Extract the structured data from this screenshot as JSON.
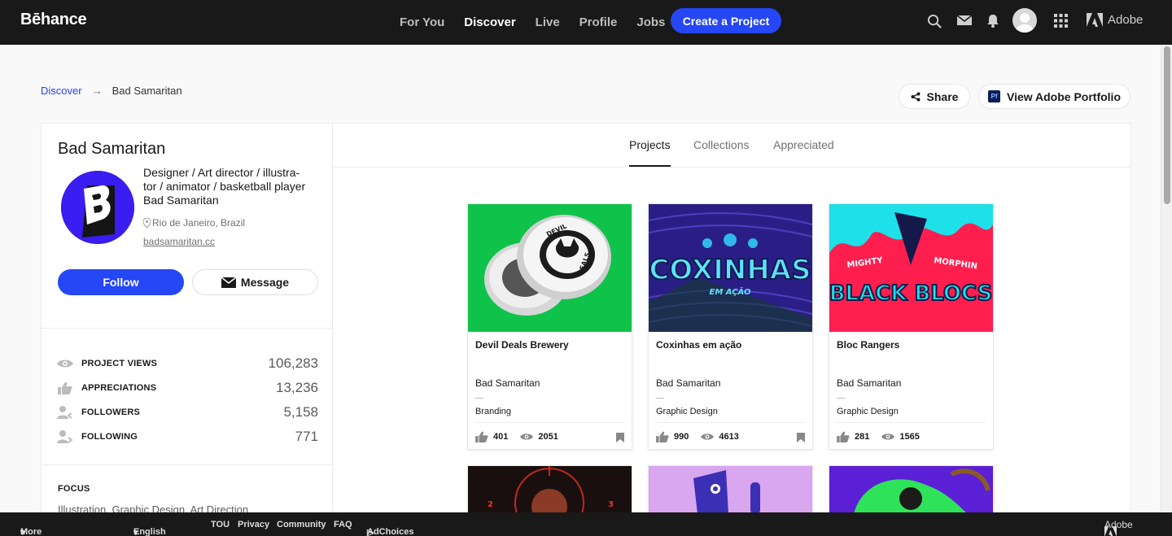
{
  "nav": {
    "logo": "Bēhance",
    "links": [
      "For You",
      "Discover",
      "Live",
      "Profile",
      "Jobs"
    ],
    "active": "Discover",
    "create_label": "Create a Project",
    "adobe_label": "Adobe"
  },
  "breadcrumb": {
    "root": "Discover",
    "current": "Bad Samaritan"
  },
  "actions": {
    "share_label": "Share",
    "portfolio_label": "View Adobe Portfolio",
    "portfolio_icon_text": "Pf"
  },
  "profile": {
    "name": "Bad Samaritan",
    "bio_lines": [
      "Designer / Art director / illustra-",
      "tor / animator / basketball player",
      "Bad Samaritan"
    ],
    "location": "Rio de Janeiro, Brazil",
    "website": "badsamaritan.cc",
    "follow_label": "Follow",
    "message_label": "Message"
  },
  "stats": [
    {
      "icon": "eye-icon",
      "label": "PROJECT VIEWS",
      "value": "106,283"
    },
    {
      "icon": "thumbs-up-icon",
      "label": "APPRECIATIONS",
      "value": "13,236"
    },
    {
      "icon": "followers-icon",
      "label": "FOLLOWERS",
      "value": "5,158"
    },
    {
      "icon": "following-icon",
      "label": "FOLLOWING",
      "value": "771"
    }
  ],
  "focus": {
    "title": "FOCUS",
    "value": "Illustration, Graphic Design, Art Direction"
  },
  "tabs": [
    "Projects",
    "Collections",
    "Appreciated"
  ],
  "active_tab": "Projects",
  "projects": [
    {
      "title": "Devil Deals Brewery",
      "owner": "Bad Samaritan",
      "field": "Branding",
      "likes": "401",
      "views": "2051",
      "cover_color": "#0fc34a"
    },
    {
      "title": "Coxinhas em ação",
      "owner": "Bad Samaritan",
      "field": "Graphic Design",
      "likes": "990",
      "views": "4613",
      "cover_color": "#2a1e86"
    },
    {
      "title": "Bloc Rangers",
      "owner": "Bad Samaritan",
      "field": "Graphic Design",
      "likes": "281",
      "views": "1565",
      "cover_color": "#ff1f4f"
    }
  ],
  "cover_text": {
    "p1": [
      "DEVIL",
      "DEALS"
    ],
    "p2": [
      "COXINHAS",
      "EM AÇÃO"
    ],
    "p3": [
      "MIGHTY",
      "MORPHIN",
      "BLACK BLOCS"
    ]
  },
  "footer": {
    "more": "More Behance",
    "language": "English",
    "links": [
      "TOU",
      "Privacy",
      "Community",
      "FAQ"
    ],
    "adchoices": "AdChoices",
    "adobe": "Adobe"
  },
  "colors": {
    "accent": "#2547f6",
    "nav_bg": "#191919"
  }
}
